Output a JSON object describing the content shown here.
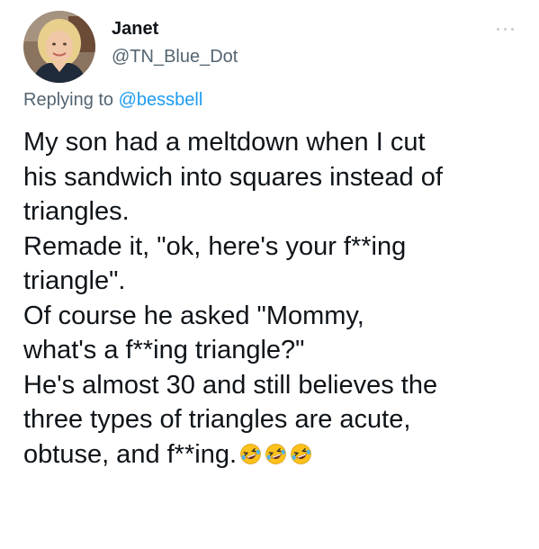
{
  "tweet": {
    "author": {
      "display_name": "Janet",
      "handle": "@TN_Blue_Dot",
      "avatar_icon": "profile-photo"
    },
    "more_icon": "more-options-icon",
    "replying_to": {
      "prefix": "Replying to",
      "mention": "@bessbell"
    },
    "body_lines": [
      "My son had a meltdown when I cut",
      "his sandwich into squares instead of",
      "triangles.",
      "Remade it, \"ok, here's your f**ing",
      "triangle\".",
      "Of course he asked \"Mommy,",
      "what's a f**ing triangle?\"",
      "He's almost 30 and still believes the",
      "three types of triangles are acute,",
      "obtuse, and f**ing."
    ],
    "emoji": [
      "rolling-on-floor-laughing-emoji",
      "rolling-on-floor-laughing-emoji",
      "rolling-on-floor-laughing-emoji"
    ]
  },
  "colors": {
    "text": "#0f1419",
    "secondary": "#536471",
    "link": "#1d9bf0",
    "emoji_face": "#fcc21b"
  }
}
